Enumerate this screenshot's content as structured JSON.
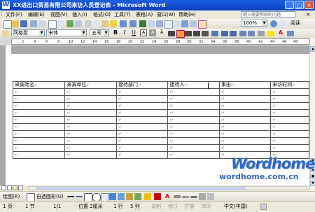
{
  "window": {
    "title": "XX进出口贸易有限公司来访人员登记表 - Microsoft Word",
    "app_icon": "W",
    "controls": [
      "minimize-icon",
      "maximize-icon",
      "close-icon"
    ]
  },
  "menubar": {
    "items": [
      "文件(F)",
      "编辑(E)",
      "视图(V)",
      "插入(I)",
      "格式(O)",
      "工具(T)",
      "表格(A)",
      "窗口(W)",
      "帮助(H)"
    ],
    "help_placeholder": "键入需要帮助的问题",
    "close_glyph": "×"
  },
  "toolbar": {
    "zoom": "100%",
    "read_label": "阅读"
  },
  "format_toolbar": {
    "style": "网格型",
    "font": "宋体",
    "size": "五号",
    "bold": "B",
    "italic": "I",
    "underline": "U",
    "charscale": "A"
  },
  "ruler": {
    "numbers": [
      "2",
      "4",
      "6",
      "8",
      "10",
      "12",
      "14",
      "16",
      "18",
      "20",
      "22",
      "24",
      "26",
      "28",
      "30",
      "32",
      "34",
      "36",
      "38",
      "40",
      "42",
      "44",
      "46",
      "48"
    ]
  },
  "document": {
    "table": {
      "headers": [
        "来宾姓名",
        "来宾单位",
        "接待部门",
        "接待人",
        "事由",
        "来访时间"
      ],
      "empty_rows": 10,
      "cell_mark": "↵"
    }
  },
  "drawbar": {
    "draw_label": "绘图(R)",
    "autoshapes_label": "自选图形(U)"
  },
  "statusbar": {
    "page": "1 页",
    "section": "1 节",
    "page_of": "1/1",
    "position": "位置 2厘米",
    "line": "1 行",
    "column": "5 列",
    "rec": "录制",
    "trk": "修订",
    "ext": "扩展",
    "ovr": "改写",
    "language": "中文(中国)"
  },
  "watermark": {
    "brand": "Wordhome",
    "url": "wordhome.com.cn"
  }
}
